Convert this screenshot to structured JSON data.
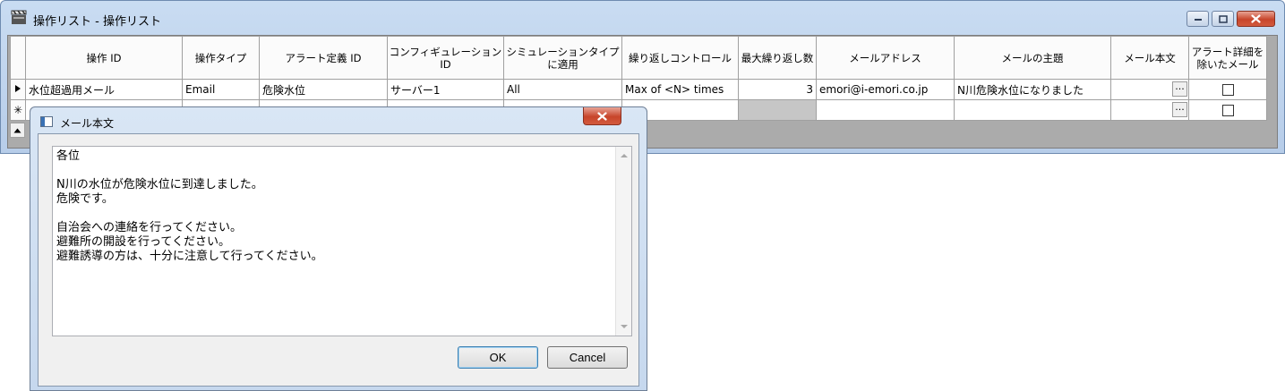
{
  "main_window": {
    "title": "操作リスト - 操作リスト"
  },
  "grid": {
    "columns": [
      "操作 ID",
      "操作タイプ",
      "アラート定義 ID",
      "コンフィギュレーション ID",
      "シミュレーションタイプに適用",
      "繰り返しコントロール",
      "最大繰り返し数",
      "メールアドレス",
      "メールの主題",
      "メール本文",
      "アラート詳細を除いたメール"
    ],
    "rows": [
      {
        "marker": "current-row-arrow",
        "operation_id": "水位超過用メール",
        "operation_type": "Email",
        "alert_definition_id": "危険水位",
        "configuration_id": "サーバー1",
        "simulation_type": "All",
        "repeat_control": "Max of <N> times",
        "max_repeat": "3",
        "email_address": "emori@i-emori.co.jp",
        "email_subject": "N川危険水位になりました",
        "ellipsis": "...",
        "exclude_alert_details": false
      },
      {
        "marker": "new-row-asterisk",
        "marker_text": "✳",
        "ellipsis": "...",
        "exclude_alert_details": false
      }
    ]
  },
  "dialog": {
    "title": "メール本文",
    "body_text": "各位\n\nN川の水位が危険水位に到達しました。\n危険です。\n\n自治会への連絡を行ってください。\n避難所の開設を行ってください。\n避難誘導の方は、十分に注意して行ってください。",
    "ok_label": "OK",
    "cancel_label": "Cancel"
  },
  "icons": {
    "app": "clapperboard-icon",
    "dialog": "window-icon",
    "minimize": "minimize-icon",
    "maximize": "maximize-icon",
    "close": "close-icon",
    "row_current": "triangle-right-icon",
    "scroll_up": "triangle-up-icon"
  },
  "colors": {
    "close_button": "#c7452b",
    "titlebar": "#c9dcf2",
    "disabled_cell": "#c6c6c6",
    "grid_background": "#ababab"
  }
}
